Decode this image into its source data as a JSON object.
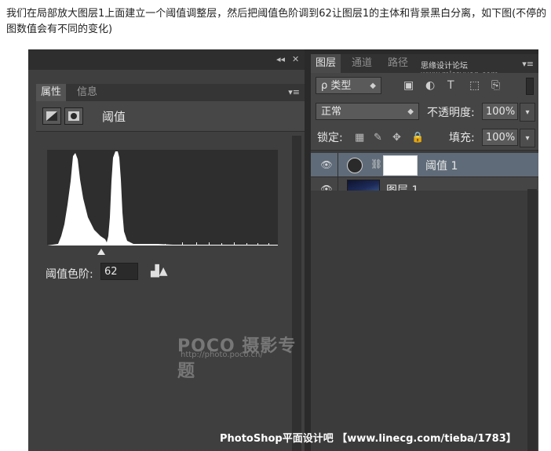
{
  "intro_text": "我们在局部放大图层1上面建立一个阈值调整层，然后把阈值色阶调到62让图层1的主体和背景黑白分离，如下图(不停的图数值会有不同的变化)",
  "properties_panel": {
    "tabs": [
      "属性",
      "信息"
    ],
    "title": "阈值",
    "threshold_label": "阈值色阶:",
    "threshold_value": "62",
    "histogram_marker": 0.25,
    "top_controls": [
      "◂◂",
      "✕"
    ],
    "menu_glyph": "▾≡"
  },
  "layers_panel": {
    "tabs": [
      "图层",
      "通道",
      "路径"
    ],
    "brand": "思缘设计论坛 www.missyuan.com",
    "filter_label": "ρ 类型",
    "blend_mode": "正常",
    "opacity_label": "不透明度:",
    "opacity_value": "100%",
    "lock_label": "锁定:",
    "fill_label": "填充:",
    "fill_value": "100%",
    "layers": [
      {
        "name": "阈值 1",
        "selected": true
      },
      {
        "name": "图层 1",
        "selected": false
      }
    ]
  },
  "watermark": {
    "logo": "POCO 摄影专题",
    "url": "http://photo.poco.cn/"
  },
  "bottom_caption": "PhotoShop平面设计吧 【www.linecg.com/tieba/1783】",
  "colors": {
    "panel_bg": "#3b3b3b",
    "selected_layer": "#5f6b78",
    "histogram_bg": "#ffffff",
    "histogram_fill": "#ffffff"
  },
  "icons": {
    "eye": "eye-icon",
    "dropdown": "caret-down-icon",
    "lock": "lock-icon"
  }
}
